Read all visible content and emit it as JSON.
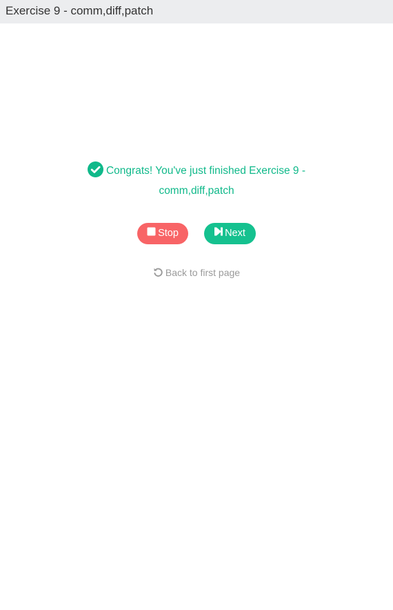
{
  "window": {
    "title": "Exercise 9 - comm,diff,patch"
  },
  "result": {
    "icon": "check-circle-icon",
    "message": "Congrats! You've just finished Exercise 9 - comm,diff,patch",
    "color": "#10b98a"
  },
  "actions": {
    "stop_label": "Stop",
    "stop_icon": "stop-square-icon",
    "stop_color": "#f86466",
    "next_label": "Next",
    "next_icon": "step-forward-icon",
    "next_color": "#15c18f"
  },
  "back": {
    "label": "Back to first page",
    "icon": "undo-icon"
  }
}
